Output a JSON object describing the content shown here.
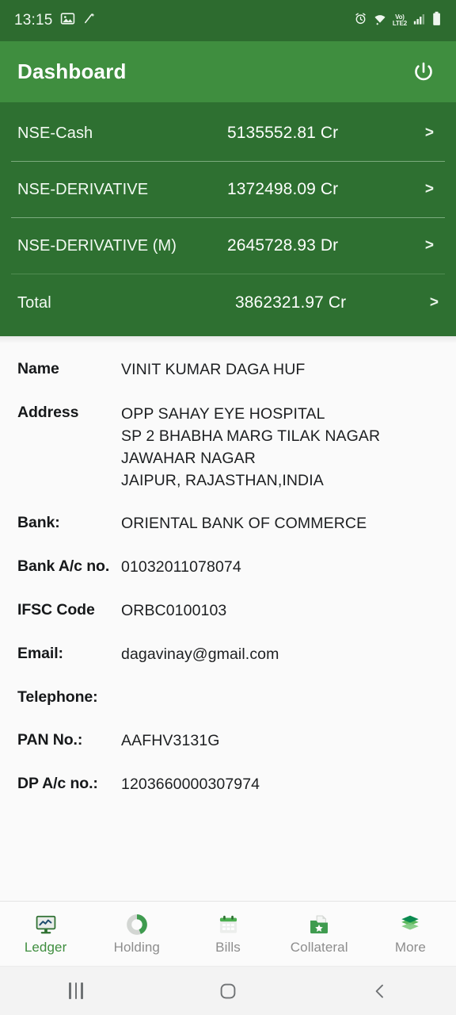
{
  "status_bar": {
    "time": "13:15",
    "left_icons": [
      "image-icon",
      "magic-wand-icon"
    ],
    "right_icons": [
      "alarm-icon",
      "wifi-icon",
      "volte-lte2-icon",
      "signal-bars-icon",
      "battery-icon"
    ],
    "network_label_top": "Vo)",
    "network_label_bottom": "LTE2"
  },
  "app_bar": {
    "title": "Dashboard",
    "power_icon": "power-icon"
  },
  "ledger": {
    "rows": [
      {
        "label": "NSE-Cash",
        "value": "5135552.81 Cr",
        "chevron": ">"
      },
      {
        "label": "NSE-DERIVATIVE",
        "value": "1372498.09 Cr",
        "chevron": ">"
      },
      {
        "label": "NSE-DERIVATIVE (M)",
        "value": "2645728.93 Dr",
        "chevron": ">"
      },
      {
        "label": "Total",
        "value": "3862321.97 Cr",
        "chevron": ">"
      }
    ]
  },
  "details": {
    "name_label": "Name",
    "name_value": "VINIT KUMAR DAGA HUF",
    "address_label": "Address",
    "address_lines": [
      "OPP SAHAY EYE HOSPITAL",
      "SP 2 BHABHA MARG TILAK NAGAR",
      "JAWAHAR NAGAR",
      "JAIPUR, RAJASTHAN,INDIA"
    ],
    "bank_label": "Bank:",
    "bank_value": "ORIENTAL BANK OF COMMERCE",
    "bank_ac_label": "Bank A/c no.",
    "bank_ac_value": "01032011078074",
    "ifsc_label": "IFSC Code",
    "ifsc_value": "ORBC0100103",
    "email_label": "Email:",
    "email_value": "dagavinay@gmail.com",
    "telephone_label": "Telephone:",
    "telephone_value": "",
    "pan_label": "PAN No.:",
    "pan_value": "AAFHV3131G",
    "dp_label": "DP A/c no.:",
    "dp_value": "1203660000307974"
  },
  "tabs": [
    {
      "label": "Ledger",
      "icon": "monitor-chart-icon",
      "active": true
    },
    {
      "label": "Holding",
      "icon": "donut-chart-icon",
      "active": false
    },
    {
      "label": "Bills",
      "icon": "calendar-icon",
      "active": false
    },
    {
      "label": "Collateral",
      "icon": "folder-star-icon",
      "active": false
    },
    {
      "label": "More",
      "icon": "layers-icon",
      "active": false
    }
  ],
  "system_nav": {
    "recents": "recents-icon",
    "home": "home-icon",
    "back": "back-icon"
  },
  "colors": {
    "status_bar": "#2d6b2f",
    "app_bar": "#3f8e3f",
    "ledger_panel": "#2e7031",
    "accent_green": "#3f8e3f",
    "body_bg": "#fafafa"
  }
}
